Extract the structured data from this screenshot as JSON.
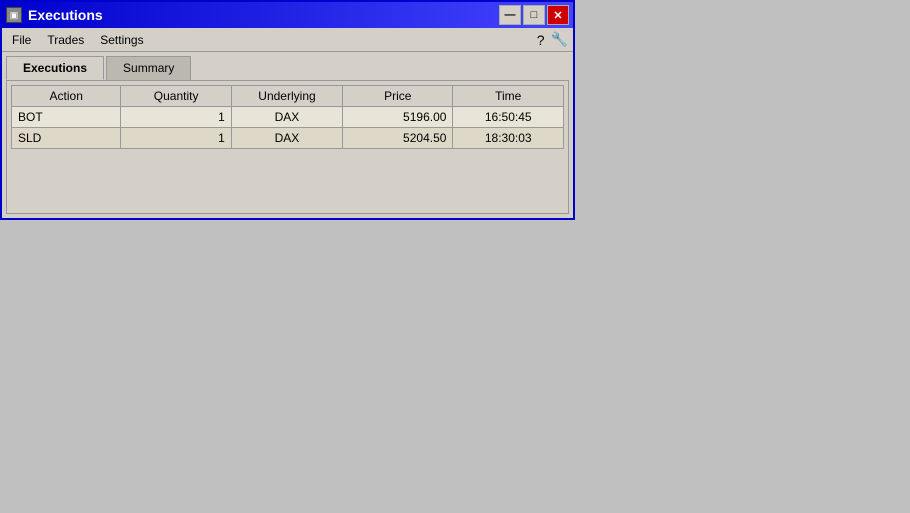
{
  "window": {
    "title": "Executions",
    "icon": "▣"
  },
  "titleButtons": {
    "minimize": "—",
    "maximize": "□",
    "close": "✕"
  },
  "menu": {
    "items": [
      "File",
      "Trades",
      "Settings"
    ],
    "icons": [
      "?",
      "🔧"
    ]
  },
  "tabs": [
    {
      "label": "Executions",
      "active": true
    },
    {
      "label": "Summary",
      "active": false
    }
  ],
  "table": {
    "columns": [
      "Action",
      "Quantity",
      "Underlying",
      "Price",
      "Time"
    ],
    "rows": [
      {
        "action": "BOT",
        "quantity": "1",
        "underlying": "DAX",
        "price": "5196.00",
        "time": "16:50:45"
      },
      {
        "action": "SLD",
        "quantity": "1",
        "underlying": "DAX",
        "price": "5204.50",
        "time": "18:30:03"
      }
    ]
  }
}
